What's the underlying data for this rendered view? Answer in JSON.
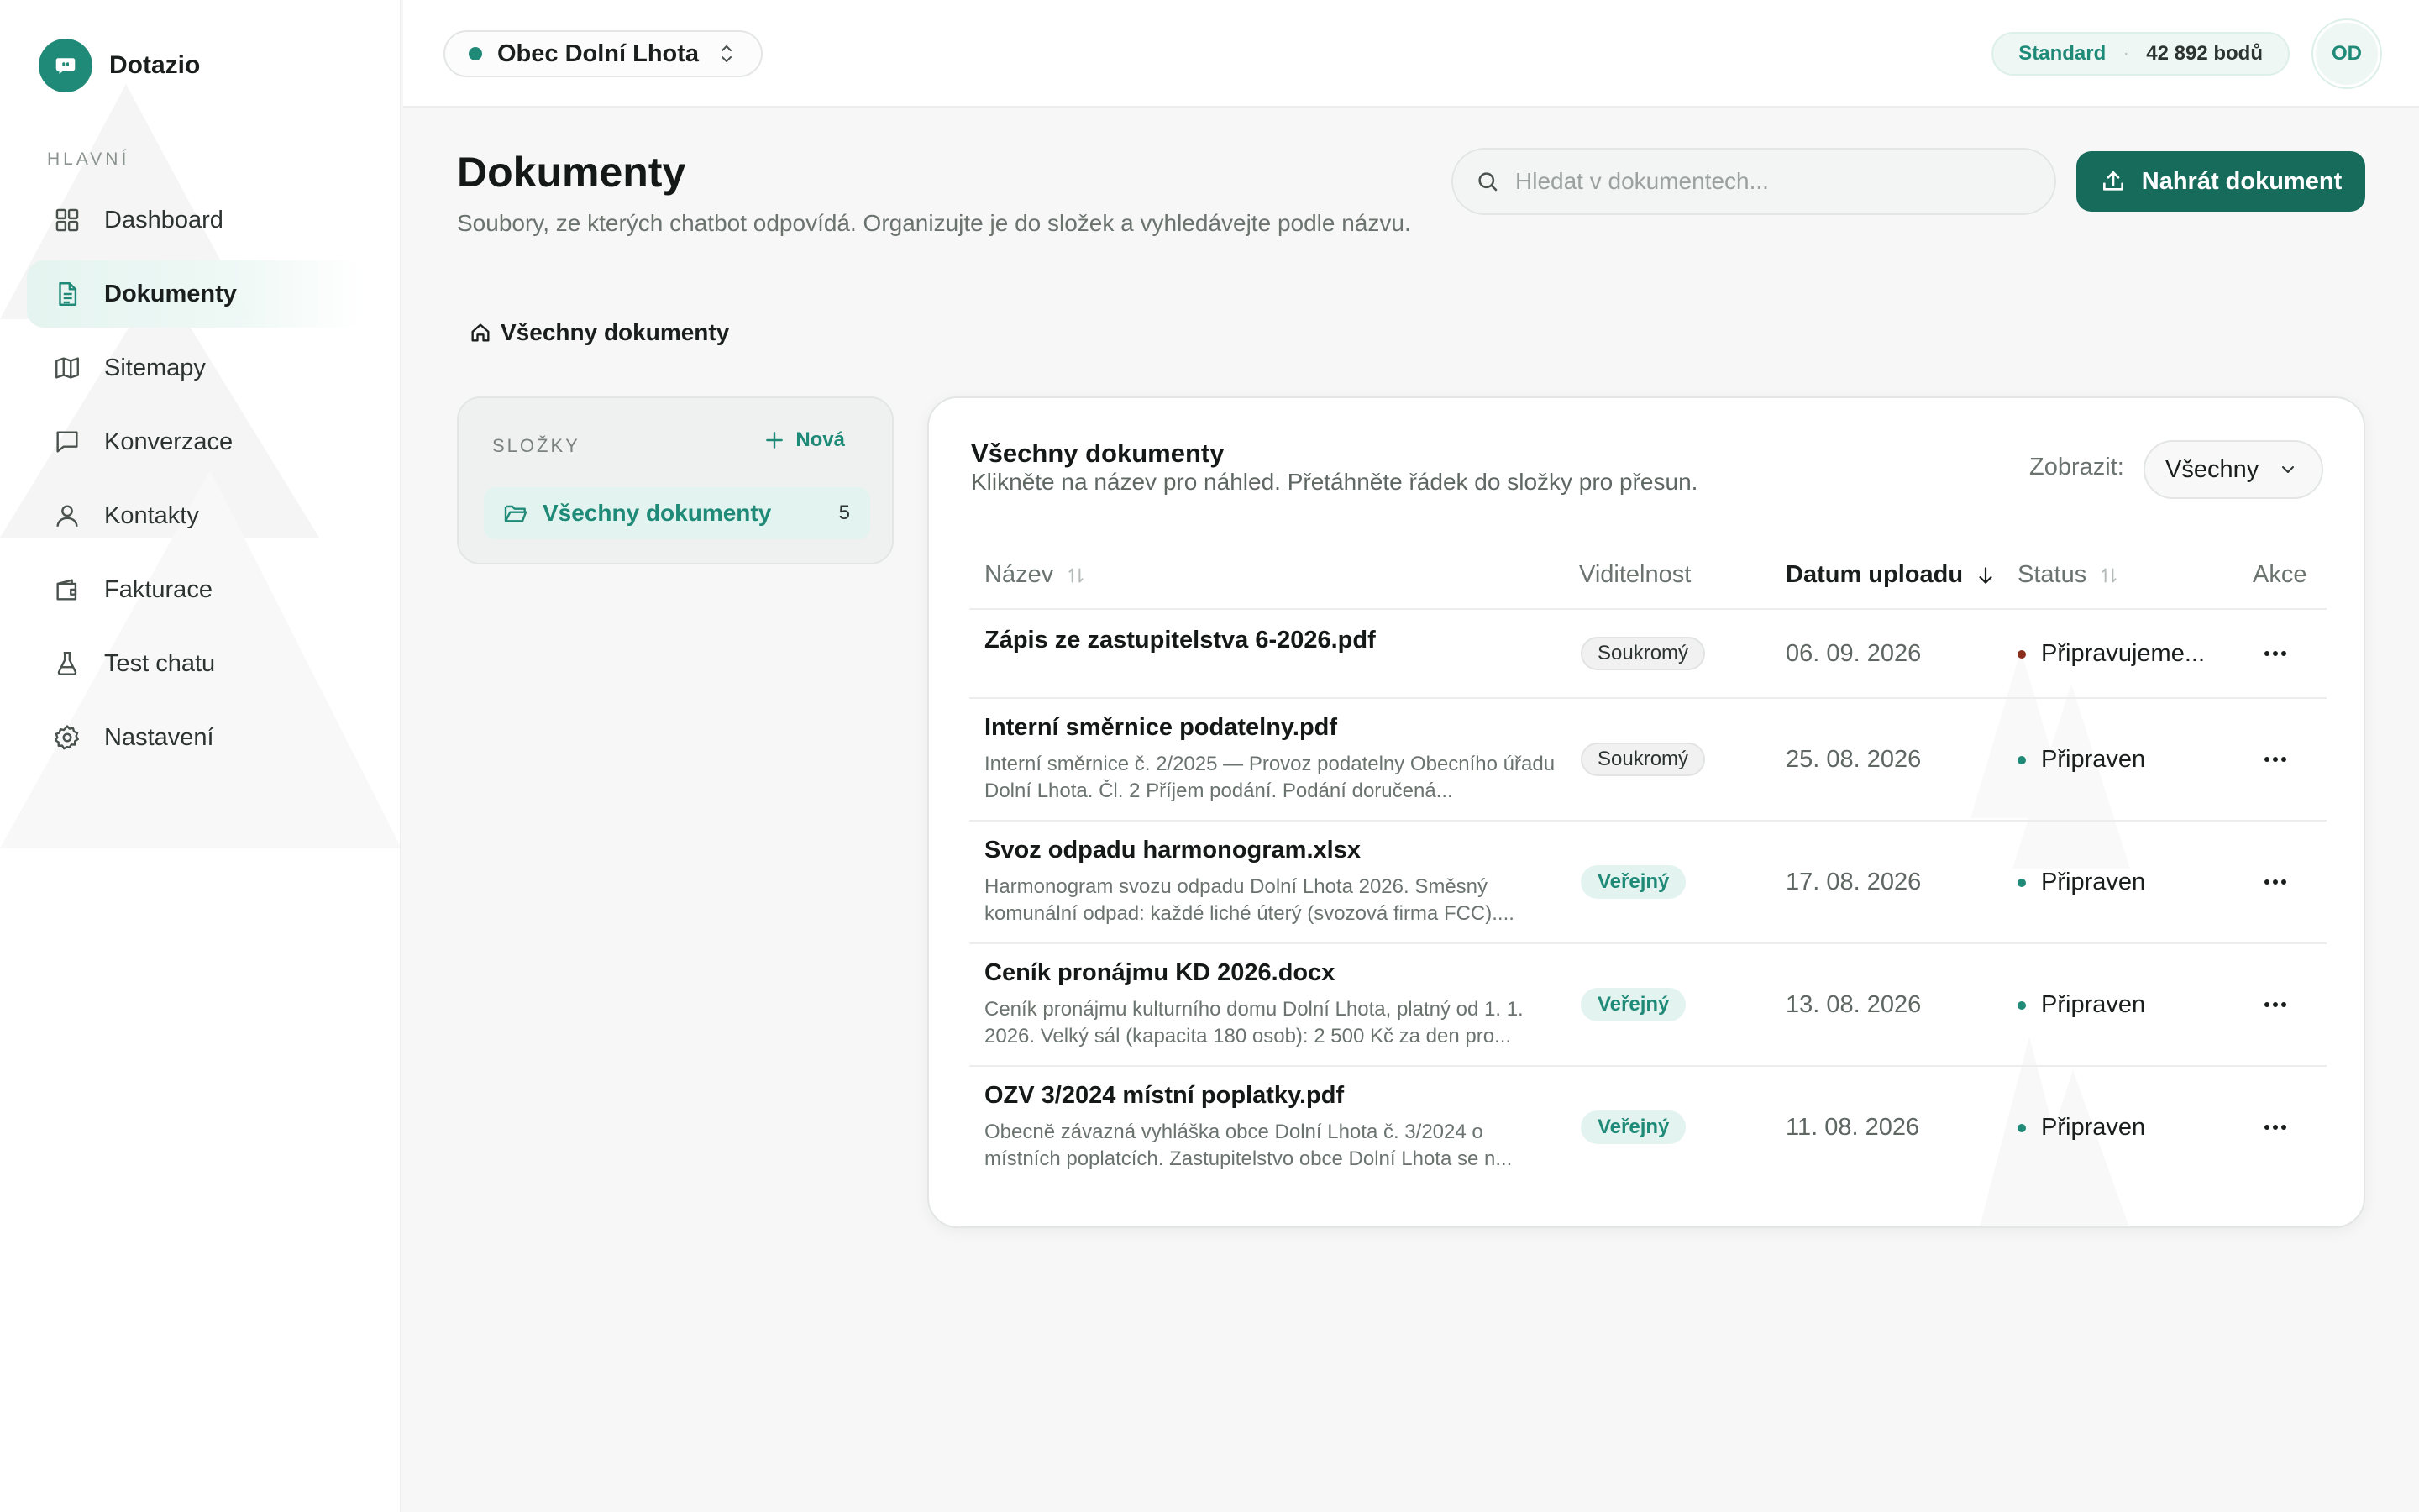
{
  "brand": {
    "name": "Dotazio"
  },
  "sidebar": {
    "section_label": "HLAVNÍ",
    "items": [
      {
        "label": "Dashboard",
        "icon": "grid-icon"
      },
      {
        "label": "Dokumenty",
        "icon": "document-icon",
        "active": true
      },
      {
        "label": "Sitemapy",
        "icon": "map-icon"
      },
      {
        "label": "Konverzace",
        "icon": "chat-icon"
      },
      {
        "label": "Kontakty",
        "icon": "user-icon"
      },
      {
        "label": "Fakturace",
        "icon": "wallet-icon"
      },
      {
        "label": "Test chatu",
        "icon": "flask-icon"
      },
      {
        "label": "Nastavení",
        "icon": "gear-icon"
      }
    ]
  },
  "topbar": {
    "org_name": "Obec Dolní Lhota",
    "plan_name": "Standard",
    "plan_separator": "·",
    "points": "42 892 bodů",
    "avatar_initials": "OD"
  },
  "page": {
    "title": "Dokumenty",
    "subtitle": "Soubory, ze kterých chatbot odpovídá. Organizujte je do složek a vyhledávejte podle názvu.",
    "search_placeholder": "Hledat v dokumentech...",
    "upload_label": "Nahrát dokument",
    "breadcrumb": "Všechny dokumenty"
  },
  "folders": {
    "heading": "SLOŽKY",
    "new_label": "Nová",
    "items": [
      {
        "label": "Všechny dokumenty",
        "count": "5"
      }
    ]
  },
  "documents": {
    "title": "Všechny dokumenty",
    "subtitle": "Klikněte na název pro náhled. Přetáhněte řádek do složky pro přesun.",
    "view_label": "Zobrazit:",
    "view_value": "Všechny",
    "columns": {
      "name": "Název",
      "visibility": "Viditelnost",
      "date": "Datum uploadu",
      "status": "Status",
      "actions": "Akce"
    },
    "rows": [
      {
        "name": "Zápis ze zastupitelstva 6-2026.pdf",
        "desc": "",
        "visibility": "Soukromý",
        "public": false,
        "date": "06. 09. 2026",
        "status": "Připravujeme...",
        "status_color": "#8a2e1c"
      },
      {
        "name": "Interní směrnice podatelny.pdf",
        "desc": "Interní směrnice č. 2/2025 — Provoz podatelny Obecního úřadu Dolní Lhota. Čl. 2 Příjem podání. Podání doručená...",
        "visibility": "Soukromý",
        "public": false,
        "date": "25. 08. 2026",
        "status": "Připraven",
        "status_color": "#1f8a78"
      },
      {
        "name": "Svoz odpadu harmonogram.xlsx",
        "desc": "Harmonogram svozu odpadu Dolní Lhota 2026. Směsný komunální odpad: každé liché úterý (svozová firma FCC)....",
        "visibility": "Veřejný",
        "public": true,
        "date": "17. 08. 2026",
        "status": "Připraven",
        "status_color": "#1f8a78"
      },
      {
        "name": "Ceník pronájmu KD 2026.docx",
        "desc": "Ceník pronájmu kulturního domu Dolní Lhota, platný od 1. 1. 2026. Velký sál (kapacita 180 osob): 2 500 Kč za den pro...",
        "visibility": "Veřejný",
        "public": true,
        "date": "13. 08. 2026",
        "status": "Připraven",
        "status_color": "#1f8a78"
      },
      {
        "name": "OZV 3/2024 místní poplatky.pdf",
        "desc": "Obecně závazná vyhláška obce Dolní Lhota č. 3/2024 o místních poplatcích. Zastupitelstvo obce Dolní Lhota se n...",
        "visibility": "Veřejný",
        "public": true,
        "date": "11. 08. 2026",
        "status": "Připraven",
        "status_color": "#1f8a78"
      }
    ]
  },
  "colors": {
    "accent": "#1f8a78",
    "primary_button": "#166b5b",
    "active_nav_bg": "#e5f4f0",
    "pending_status": "#8a2e1c"
  }
}
